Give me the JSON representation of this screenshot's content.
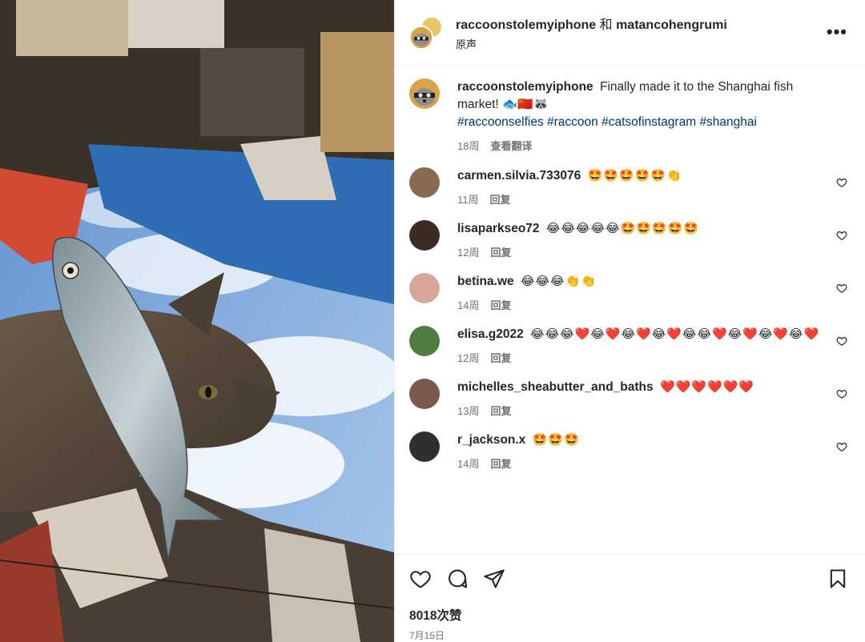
{
  "header": {
    "user1": "raccoonstolemyiphone",
    "separator": "和",
    "user2": "matancohengrumi",
    "audio": "原声",
    "more": "•••"
  },
  "caption": {
    "user": "raccoonstolemyiphone",
    "text": "Finally made it to the Shanghai fish market! 🐟🇨🇳🦝",
    "hashtags": [
      "#raccoonselfies",
      "#raccoon",
      "#catsofinstagram",
      "#shanghai"
    ],
    "time": "18周",
    "translate": "查看翻译"
  },
  "comments": [
    {
      "user": "carmen.silvia.733076",
      "text": "🤩🤩🤩🤩🤩👏",
      "time": "11周",
      "reply": "回复",
      "avatar_color": "#8a6a4f"
    },
    {
      "user": "lisaparkseo72",
      "text": "😂😂😂😂😂🤩🤩🤩🤩🤩",
      "time": "12周",
      "reply": "回复",
      "avatar_color": "#3a2c25"
    },
    {
      "user": "betina.we",
      "text": "😂😂😂👏👏",
      "time": "14周",
      "reply": "回复",
      "avatar_color": "#d9a79a"
    },
    {
      "user": "elisa.g2022",
      "text": "😂😂😂❤️😂❤️😂❤️😂❤️😂😂❤️😂❤️😂❤️😂❤️",
      "time": "12周",
      "reply": "回复",
      "avatar_color": "#4f7d3f"
    },
    {
      "user": "michelles_sheabutter_and_baths",
      "text": "❤️❤️❤️❤️❤️❤️",
      "time": "13周",
      "reply": "回复",
      "avatar_color": "#7a5a4c"
    },
    {
      "user": "r_jackson.x",
      "text": "🤩🤩🤩",
      "time": "14周",
      "reply": "回复",
      "avatar_color": "#2f2f2f"
    }
  ],
  "footer": {
    "likes": "8018次赞",
    "date": "7月15日"
  },
  "colors": {
    "text": "#262626",
    "muted": "#737373",
    "hashtag": "#00376b",
    "border": "#efefef"
  },
  "icons": {
    "like": "heart-icon",
    "comment": "comment-icon",
    "share": "share-icon",
    "save": "bookmark-icon",
    "more": "more-icon"
  }
}
